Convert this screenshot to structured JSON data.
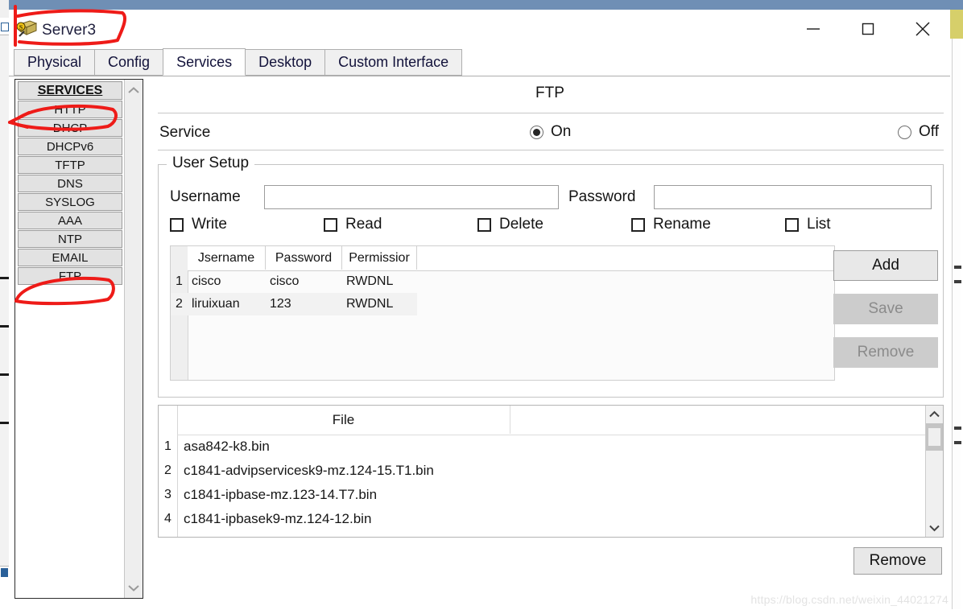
{
  "window": {
    "title": "Server3",
    "icon": "server-icon",
    "controls": {
      "minimize": "minimize-icon",
      "maximize": "maximize-icon",
      "close": "close-icon"
    }
  },
  "tabs": [
    {
      "label": "Physical",
      "active": false
    },
    {
      "label": "Config",
      "active": false
    },
    {
      "label": "Services",
      "active": true
    },
    {
      "label": "Desktop",
      "active": false
    },
    {
      "label": "Custom Interface",
      "active": false
    }
  ],
  "sidebar": {
    "header": "SERVICES",
    "items": [
      {
        "label": "HTTP"
      },
      {
        "label": "DHCP"
      },
      {
        "label": "DHCPv6"
      },
      {
        "label": "TFTP"
      },
      {
        "label": "DNS"
      },
      {
        "label": "SYSLOG"
      },
      {
        "label": "AAA"
      },
      {
        "label": "NTP"
      },
      {
        "label": "EMAIL"
      },
      {
        "label": "FTP"
      }
    ],
    "scroll_up": "chevron-up-icon",
    "scroll_down": "chevron-down-icon"
  },
  "panel": {
    "title": "FTP",
    "service": {
      "label": "Service",
      "on_label": "On",
      "off_label": "Off",
      "selected": "On"
    },
    "user_setup": {
      "legend": "User Setup",
      "username_label": "Username",
      "username_value": "",
      "username_placeholder": "",
      "password_label": "Password",
      "password_value": "",
      "password_placeholder": "",
      "permissions": [
        {
          "label": "Write",
          "checked": false
        },
        {
          "label": "Read",
          "checked": false
        },
        {
          "label": "Delete",
          "checked": false
        },
        {
          "label": "Rename",
          "checked": false
        },
        {
          "label": "List",
          "checked": false
        }
      ],
      "table": {
        "columns": [
          "Jsername",
          "Password",
          "Permissior"
        ],
        "rows": [
          {
            "index": "1",
            "username": "cisco",
            "password": "cisco",
            "permission": "RWDNL"
          },
          {
            "index": "2",
            "username": "liruixuan",
            "password": "123",
            "permission": "RWDNL"
          }
        ]
      },
      "buttons": [
        {
          "label": "Add",
          "enabled": true
        },
        {
          "label": "Save",
          "enabled": false
        },
        {
          "label": "Remove",
          "enabled": false
        }
      ]
    },
    "file_list": {
      "column": "File",
      "rows": [
        {
          "index": "1",
          "name": "asa842-k8.bin"
        },
        {
          "index": "2",
          "name": "c1841-advipservicesk9-mz.124-15.T1.bin"
        },
        {
          "index": "3",
          "name": "c1841-ipbase-mz.123-14.T7.bin"
        },
        {
          "index": "4",
          "name": "c1841-ipbasek9-mz.124-12.bin"
        }
      ],
      "scroll_up": "chevron-up-icon",
      "scroll_down": "chevron-down-icon"
    },
    "remove_button": "Remove"
  },
  "watermark": "https://blog.csdn.net/weixin_44021274",
  "colors": {
    "annotation_red": "#ee1b18",
    "tab_active_bg": "#ffffff",
    "tab_inactive_bg": "#f0f0f0",
    "sidebar_item_bg": "#e2e2e2",
    "disabled_button_bg": "#cccccc",
    "titlebar_band": "#6f8fb5",
    "background_accent_yellow": "#d6cf6a"
  }
}
